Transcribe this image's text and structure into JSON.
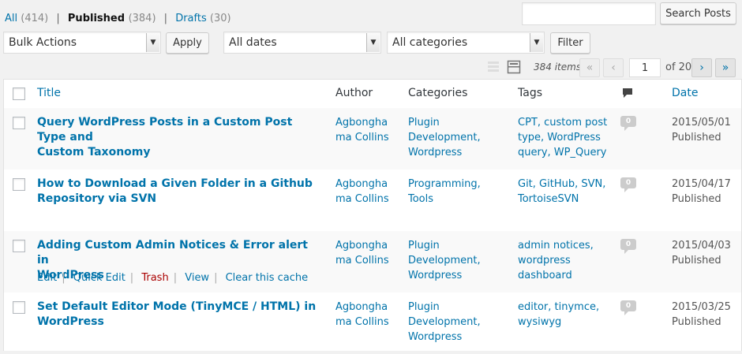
{
  "filters": {
    "all_label": "All",
    "all_count": "(414)",
    "published_label": "Published",
    "published_count": "(384)",
    "drafts_label": "Drafts",
    "drafts_count": "(30)",
    "separator": "|"
  },
  "search": {
    "value": "",
    "button_label": "Search Posts"
  },
  "toolbar": {
    "bulk_actions": "Bulk Actions",
    "apply_label": "Apply",
    "dates": "All dates",
    "categories": "All categories",
    "filter_label": "Filter"
  },
  "pagination": {
    "items": "384 items",
    "first": "«",
    "prev": "‹",
    "current_page": "1",
    "of_total": "of 20",
    "next": "›",
    "last": "»"
  },
  "columns": {
    "title": "Title",
    "author": "Author",
    "categories": "Categories",
    "tags": "Tags",
    "date": "Date"
  },
  "rows": [
    {
      "title_l1": "Query WordPress Posts in a Custom Post Type and",
      "title_l2": "Custom Taxonomy",
      "author_l1": "Agbongha",
      "author_l2": "ma Collins",
      "cat_l1": "Plugin",
      "cat_l2": "Development,",
      "cat_l3": "Wordpress",
      "tag_l1": "CPT, custom post",
      "tag_l2": "type, WordPress",
      "tag_l3": "query, WP_Query",
      "comments": "0",
      "date": "2015/05/01",
      "status": "Published"
    },
    {
      "title_l1": "How to Download a Given Folder in a Github",
      "title_l2": "Repository via SVN",
      "author_l1": "Agbongha",
      "author_l2": "ma Collins",
      "cat_l1": "Programming,",
      "cat_l2": "Tools",
      "cat_l3": "",
      "tag_l1": "Git, GitHub, SVN,",
      "tag_l2": "TortoiseSVN",
      "tag_l3": "",
      "comments": "0",
      "date": "2015/04/17",
      "status": "Published"
    },
    {
      "title_l1": "Adding Custom Admin Notices & Error alert in",
      "title_l2": "WordPress",
      "author_l1": "Agbongha",
      "author_l2": "ma Collins",
      "cat_l1": "Plugin",
      "cat_l2": "Development,",
      "cat_l3": "Wordpress",
      "tag_l1": "admin notices,",
      "tag_l2": "wordpress",
      "tag_l3": "dashboard",
      "comments": "0",
      "date": "2015/04/03",
      "status": "Published",
      "actions": {
        "edit": "Edit",
        "quick_edit": "Quick Edit",
        "trash": "Trash",
        "view": "View",
        "clear_cache": "Clear this cache"
      }
    },
    {
      "title_l1": "Set Default Editor Mode (TinyMCE / HTML) in",
      "title_l2": "WordPress",
      "author_l1": "Agbongha",
      "author_l2": "ma Collins",
      "cat_l1": "Plugin",
      "cat_l2": "Development,",
      "cat_l3": "Wordpress",
      "tag_l1": "editor, tinymce,",
      "tag_l2": "wysiwyg",
      "tag_l3": "",
      "comments": "0",
      "date": "2015/03/25",
      "status": "Published"
    }
  ],
  "colors": {
    "link": "#0073aa",
    "trash": "#a00",
    "background": "#f1f1f1",
    "alt_row": "#f9f9f9"
  }
}
